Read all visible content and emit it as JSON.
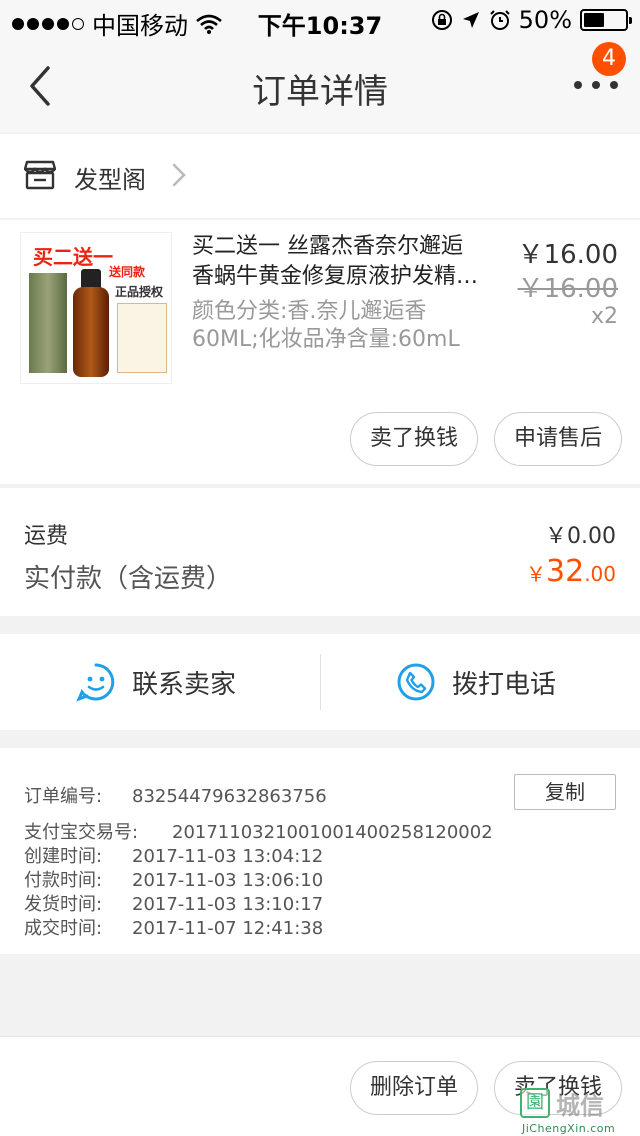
{
  "status_bar": {
    "carrier": "中国移动",
    "time": "下午10:37",
    "battery_percent": "50%",
    "battery_level": 0.5
  },
  "nav": {
    "title": "订单详情",
    "badge_count": "4"
  },
  "shop": {
    "name": "发型阁"
  },
  "product": {
    "image_text": {
      "promo": "买二送一",
      "line1": "送同款",
      "line2": "正品授权"
    },
    "title_line1": "买二送一 丝露杰香奈尔邂逅",
    "title_line2": "香蜗牛黄金修复原液护发精…",
    "sku_line1": "颜色分类:香.奈儿邂逅香",
    "sku_line2": "60ML;化妆品净含量:60mL",
    "price": "￥16.00",
    "original_price": "￥16.00",
    "quantity": "x2",
    "buttons": {
      "resell": "卖了换钱",
      "after_sale": "申请售后"
    }
  },
  "summary": {
    "shipping_label": "运费",
    "shipping_value": "￥0.00",
    "total_label": "实付款（含运费）",
    "total_currency": "￥",
    "total_integer": "32",
    "total_decimal": ".00"
  },
  "contact": {
    "seller_label": "联系卖家",
    "call_label": "拨打电话"
  },
  "order_info": {
    "copy_label": "复制",
    "rows": [
      {
        "label": "订单编号:",
        "value": "83254479632863756"
      },
      {
        "label": "支付宝交易号:",
        "value": "2017110321001001400258120002"
      },
      {
        "label": "创建时间:",
        "value": "2017-11-03 13:04:12"
      },
      {
        "label": "付款时间:",
        "value": "2017-11-03 13:06:10"
      },
      {
        "label": "发货时间:",
        "value": "2017-11-03 13:10:17"
      },
      {
        "label": "成交时间:",
        "value": "2017-11-07 12:41:38"
      }
    ]
  },
  "bottom_bar": {
    "delete_label": "删除订单",
    "resell_label": "卖了换钱"
  },
  "watermark": {
    "logo_char": "園",
    "text": "城信",
    "url": "JiChengXin.com"
  },
  "colors": {
    "accent": "#ff5000",
    "contact_icon": "#1ea1e8",
    "watermark_green": "#3cb371"
  }
}
